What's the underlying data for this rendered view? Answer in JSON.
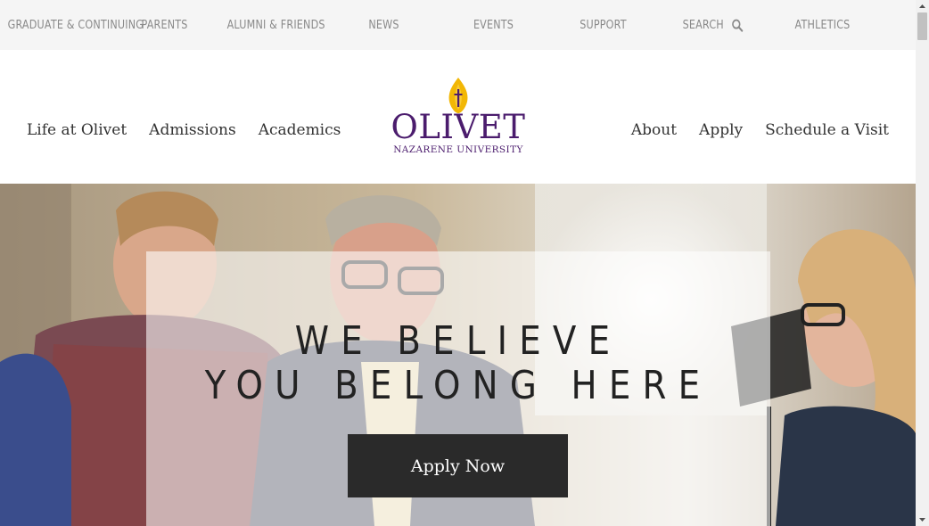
{
  "utility_nav": {
    "items": [
      "GRADUATE & CONTINUING",
      "PARENTS",
      "ALUMNI & FRIENDS",
      "NEWS",
      "EVENTS",
      "SUPPORT",
      "SEARCH",
      "ATHLETICS"
    ],
    "search_icon": "search-icon"
  },
  "main_nav": {
    "left": [
      "Life at Olivet",
      "Admissions",
      "Academics"
    ],
    "right": [
      "About",
      "Apply",
      "Schedule a Visit"
    ]
  },
  "logo": {
    "name": "OLIVET",
    "subtitle": "NAZARENE UNIVERSITY",
    "brand_color": "#4b1c6d",
    "flame_color": "#f2b705"
  },
  "hero": {
    "line1": "WE BELIEVE",
    "line2": "YOU BELONG HERE",
    "cta": "Apply Now"
  },
  "colors": {
    "utility_bg": "#f5f5f5",
    "utility_text": "#8a8a8a",
    "cta_bg": "#2a2a2a"
  }
}
